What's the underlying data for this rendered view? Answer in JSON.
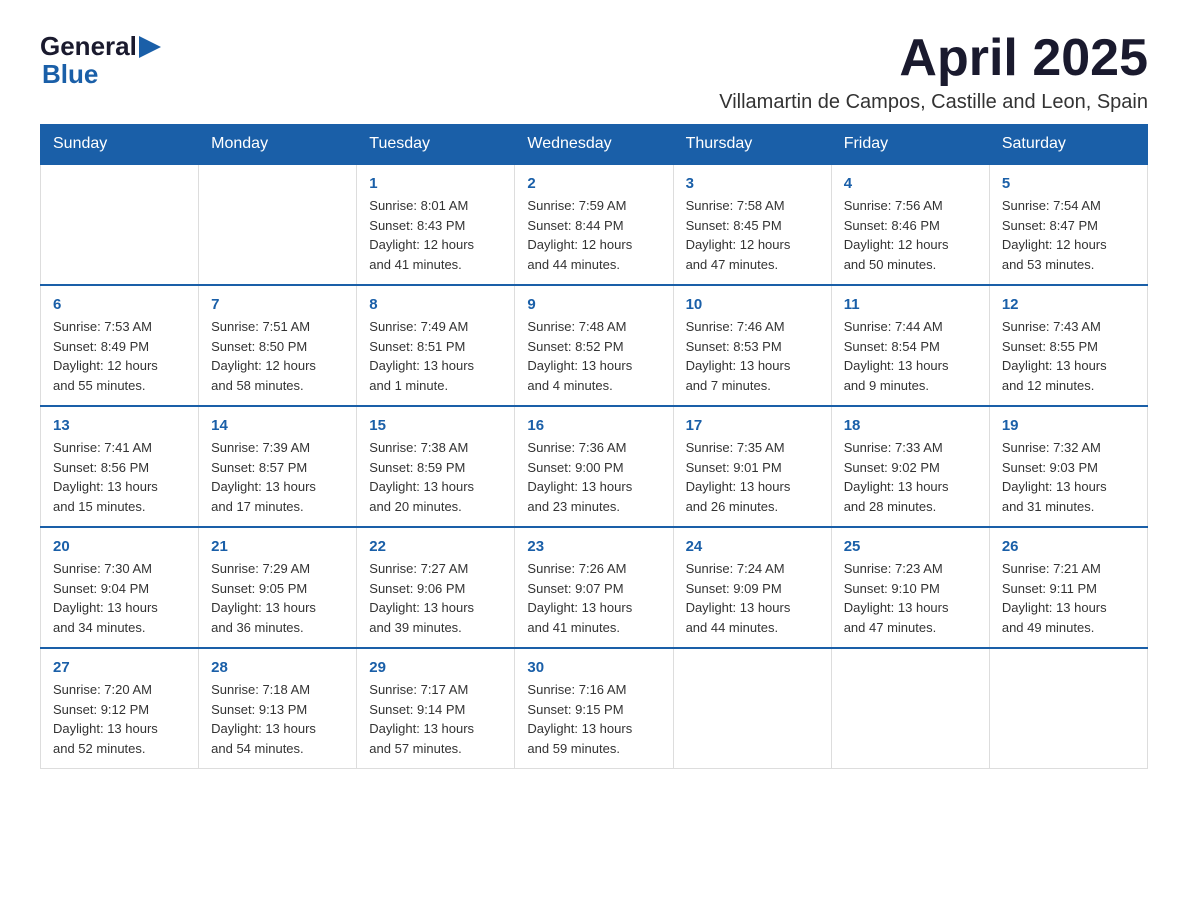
{
  "logo": {
    "text_general": "General",
    "text_blue": "Blue"
  },
  "header": {
    "month_title": "April 2025",
    "location": "Villamartin de Campos, Castille and Leon, Spain"
  },
  "weekdays": [
    "Sunday",
    "Monday",
    "Tuesday",
    "Wednesday",
    "Thursday",
    "Friday",
    "Saturday"
  ],
  "weeks": [
    [
      {
        "day": "",
        "info": ""
      },
      {
        "day": "",
        "info": ""
      },
      {
        "day": "1",
        "info": "Sunrise: 8:01 AM\nSunset: 8:43 PM\nDaylight: 12 hours\nand 41 minutes."
      },
      {
        "day": "2",
        "info": "Sunrise: 7:59 AM\nSunset: 8:44 PM\nDaylight: 12 hours\nand 44 minutes."
      },
      {
        "day": "3",
        "info": "Sunrise: 7:58 AM\nSunset: 8:45 PM\nDaylight: 12 hours\nand 47 minutes."
      },
      {
        "day": "4",
        "info": "Sunrise: 7:56 AM\nSunset: 8:46 PM\nDaylight: 12 hours\nand 50 minutes."
      },
      {
        "day": "5",
        "info": "Sunrise: 7:54 AM\nSunset: 8:47 PM\nDaylight: 12 hours\nand 53 minutes."
      }
    ],
    [
      {
        "day": "6",
        "info": "Sunrise: 7:53 AM\nSunset: 8:49 PM\nDaylight: 12 hours\nand 55 minutes."
      },
      {
        "day": "7",
        "info": "Sunrise: 7:51 AM\nSunset: 8:50 PM\nDaylight: 12 hours\nand 58 minutes."
      },
      {
        "day": "8",
        "info": "Sunrise: 7:49 AM\nSunset: 8:51 PM\nDaylight: 13 hours\nand 1 minute."
      },
      {
        "day": "9",
        "info": "Sunrise: 7:48 AM\nSunset: 8:52 PM\nDaylight: 13 hours\nand 4 minutes."
      },
      {
        "day": "10",
        "info": "Sunrise: 7:46 AM\nSunset: 8:53 PM\nDaylight: 13 hours\nand 7 minutes."
      },
      {
        "day": "11",
        "info": "Sunrise: 7:44 AM\nSunset: 8:54 PM\nDaylight: 13 hours\nand 9 minutes."
      },
      {
        "day": "12",
        "info": "Sunrise: 7:43 AM\nSunset: 8:55 PM\nDaylight: 13 hours\nand 12 minutes."
      }
    ],
    [
      {
        "day": "13",
        "info": "Sunrise: 7:41 AM\nSunset: 8:56 PM\nDaylight: 13 hours\nand 15 minutes."
      },
      {
        "day": "14",
        "info": "Sunrise: 7:39 AM\nSunset: 8:57 PM\nDaylight: 13 hours\nand 17 minutes."
      },
      {
        "day": "15",
        "info": "Sunrise: 7:38 AM\nSunset: 8:59 PM\nDaylight: 13 hours\nand 20 minutes."
      },
      {
        "day": "16",
        "info": "Sunrise: 7:36 AM\nSunset: 9:00 PM\nDaylight: 13 hours\nand 23 minutes."
      },
      {
        "day": "17",
        "info": "Sunrise: 7:35 AM\nSunset: 9:01 PM\nDaylight: 13 hours\nand 26 minutes."
      },
      {
        "day": "18",
        "info": "Sunrise: 7:33 AM\nSunset: 9:02 PM\nDaylight: 13 hours\nand 28 minutes."
      },
      {
        "day": "19",
        "info": "Sunrise: 7:32 AM\nSunset: 9:03 PM\nDaylight: 13 hours\nand 31 minutes."
      }
    ],
    [
      {
        "day": "20",
        "info": "Sunrise: 7:30 AM\nSunset: 9:04 PM\nDaylight: 13 hours\nand 34 minutes."
      },
      {
        "day": "21",
        "info": "Sunrise: 7:29 AM\nSunset: 9:05 PM\nDaylight: 13 hours\nand 36 minutes."
      },
      {
        "day": "22",
        "info": "Sunrise: 7:27 AM\nSunset: 9:06 PM\nDaylight: 13 hours\nand 39 minutes."
      },
      {
        "day": "23",
        "info": "Sunrise: 7:26 AM\nSunset: 9:07 PM\nDaylight: 13 hours\nand 41 minutes."
      },
      {
        "day": "24",
        "info": "Sunrise: 7:24 AM\nSunset: 9:09 PM\nDaylight: 13 hours\nand 44 minutes."
      },
      {
        "day": "25",
        "info": "Sunrise: 7:23 AM\nSunset: 9:10 PM\nDaylight: 13 hours\nand 47 minutes."
      },
      {
        "day": "26",
        "info": "Sunrise: 7:21 AM\nSunset: 9:11 PM\nDaylight: 13 hours\nand 49 minutes."
      }
    ],
    [
      {
        "day": "27",
        "info": "Sunrise: 7:20 AM\nSunset: 9:12 PM\nDaylight: 13 hours\nand 52 minutes."
      },
      {
        "day": "28",
        "info": "Sunrise: 7:18 AM\nSunset: 9:13 PM\nDaylight: 13 hours\nand 54 minutes."
      },
      {
        "day": "29",
        "info": "Sunrise: 7:17 AM\nSunset: 9:14 PM\nDaylight: 13 hours\nand 57 minutes."
      },
      {
        "day": "30",
        "info": "Sunrise: 7:16 AM\nSunset: 9:15 PM\nDaylight: 13 hours\nand 59 minutes."
      },
      {
        "day": "",
        "info": ""
      },
      {
        "day": "",
        "info": ""
      },
      {
        "day": "",
        "info": ""
      }
    ]
  ]
}
